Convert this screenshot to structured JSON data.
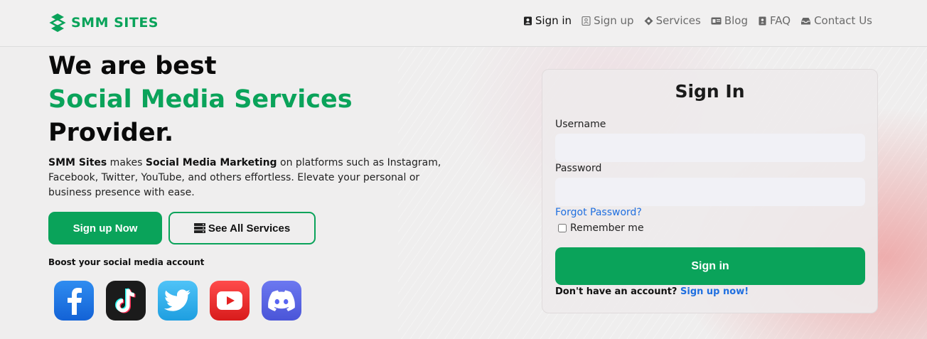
{
  "header": {
    "logo_text": "SMM SITES",
    "nav": [
      {
        "label": "Sign in",
        "icon": "person-badge-icon"
      },
      {
        "label": "Sign up",
        "icon": "person-add-icon"
      },
      {
        "label": "Services",
        "icon": "gear-icon"
      },
      {
        "label": "Blog",
        "icon": "card-icon"
      },
      {
        "label": "FAQ",
        "icon": "book-icon"
      },
      {
        "label": "Contact Us",
        "icon": "inbox-icon"
      }
    ]
  },
  "hero": {
    "title_line1": "We are best",
    "title_line2": "Social Media Services",
    "title_line3": "Provider.",
    "desc_brand": "SMM Sites",
    "desc_part1": " makes ",
    "desc_bold": "Social Media Marketing",
    "desc_part2": " on platforms such as Instagram, Facebook, Twitter, YouTube, and others effortless. Elevate your personal or business presence with ease.",
    "signup_button": "Sign up Now",
    "services_button": "See All Services",
    "boost_label": "Boost your social media account",
    "socials": [
      "facebook-icon",
      "tiktok-icon",
      "twitter-icon",
      "youtube-icon",
      "discord-icon"
    ]
  },
  "signin": {
    "title": "Sign In",
    "username_label": "Username",
    "password_label": "Password",
    "forgot": "Forgot Password?",
    "remember": "Remember me",
    "submit": "Sign in",
    "no_account": "Don't have an account?",
    "signup_link": "Sign up now!"
  },
  "colors": {
    "brand_green": "#0aa35a",
    "link_blue": "#1f6fe0"
  }
}
